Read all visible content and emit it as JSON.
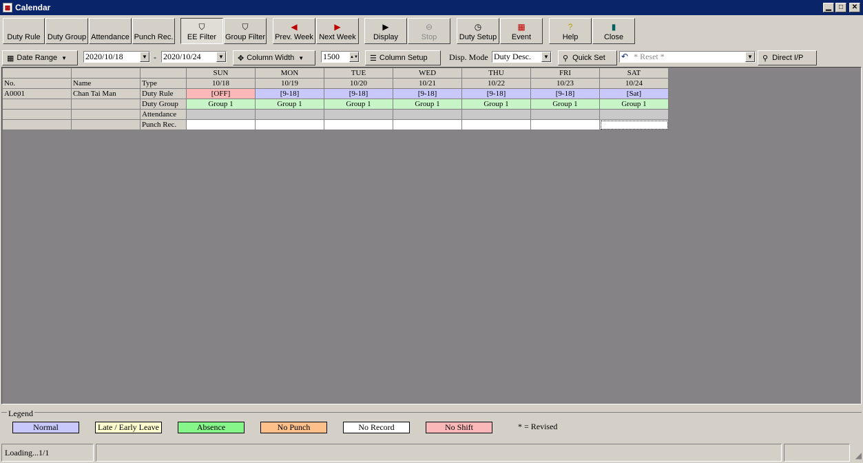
{
  "window": {
    "title": "Calendar"
  },
  "toolbar": {
    "duty_rule": "Duty Rule",
    "duty_group": "Duty Group",
    "attendance": "Attendance",
    "punch_rec": "Punch Rec.",
    "ee_filter": "EE Filter",
    "group_filter": "Group Filter",
    "prev_week": "Prev. Week",
    "next_week": "Next Week",
    "display": "Display",
    "stop": "Stop",
    "duty_setup": "Duty Setup",
    "event": "Event",
    "help": "Help",
    "close": "Close"
  },
  "filters": {
    "date_range_label": "Date Range",
    "date_from": "2020/10/18",
    "date_sep": "-",
    "date_to": "2020/10/24",
    "column_width_label": "Column Width",
    "column_width_value": "1500",
    "column_setup_label": "Column Setup",
    "disp_mode_label": "Disp. Mode",
    "disp_mode_value": "Duty Desc.",
    "quick_set_label": "Quick Set",
    "reset_placeholder": "* Reset *",
    "direct_ip_label": "Direct I/P"
  },
  "grid": {
    "left_headers": {
      "no": "No.",
      "name": "Name"
    },
    "row_labels": {
      "type": "Type",
      "duty_rule": "Duty Rule",
      "duty_group": "Duty Group",
      "attendance": "Attendance",
      "punch_rec": "Punch Rec."
    },
    "days": [
      {
        "dow": "SUN",
        "date": "10/18",
        "duty": "[OFF]",
        "group": "Group 1"
      },
      {
        "dow": "MON",
        "date": "10/19",
        "duty": "[9-18]",
        "group": "Group 1"
      },
      {
        "dow": "TUE",
        "date": "10/20",
        "duty": "[9-18]",
        "group": "Group 1"
      },
      {
        "dow": "WED",
        "date": "10/21",
        "duty": "[9-18]",
        "group": "Group 1"
      },
      {
        "dow": "THU",
        "date": "10/22",
        "duty": "[9-18]",
        "group": "Group 1"
      },
      {
        "dow": "FRI",
        "date": "10/23",
        "duty": "[9-18]",
        "group": "Group 1"
      },
      {
        "dow": "SAT",
        "date": "10/24",
        "duty": "[Sat]",
        "group": "Group 1"
      }
    ],
    "employee": {
      "no": "A0001",
      "name": "Chan Tai Man"
    }
  },
  "legend": {
    "caption": "Legend",
    "items": [
      {
        "label": "Normal",
        "color": "#c8c8fc"
      },
      {
        "label": "Late / Early Leave",
        "color": "#fdfdcf"
      },
      {
        "label": "Absence",
        "color": "#86f58a"
      },
      {
        "label": "No Punch",
        "color": "#fdc08a"
      },
      {
        "label": "No Record",
        "color": "#ffffff"
      },
      {
        "label": "No Shift",
        "color": "#fbb8b8"
      }
    ],
    "note": "* = Revised"
  },
  "status": {
    "text": "Loading...1/1"
  }
}
